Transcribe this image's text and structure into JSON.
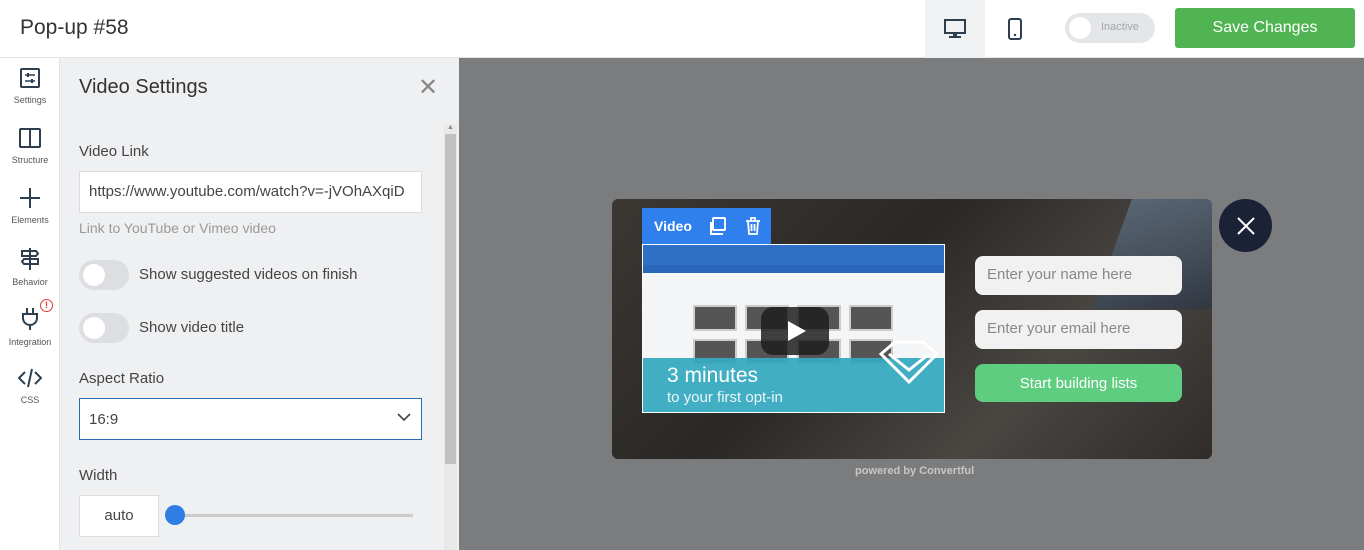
{
  "header": {
    "title": "Pop-up #58",
    "toggle_label": "Inactive",
    "save_label": "Save Changes",
    "devices": [
      "desktop-icon",
      "mobile-icon"
    ]
  },
  "nav": {
    "items": [
      {
        "label": "Settings",
        "icon": "sliders-icon"
      },
      {
        "label": "Structure",
        "icon": "columns-icon"
      },
      {
        "label": "Elements",
        "icon": "plus-icon"
      },
      {
        "label": "Behavior",
        "icon": "signpost-icon"
      },
      {
        "label": "Integration",
        "icon": "plug-icon",
        "badge": "!"
      },
      {
        "label": "CSS",
        "icon": "code-icon"
      }
    ]
  },
  "panel": {
    "title": "Video Settings",
    "video_link_label": "Video Link",
    "video_link_value": "https://www.youtube.com/watch?v=-jVOhAXqiD",
    "video_link_hint": "Link to YouTube or Vimeo video",
    "toggle_suggested": "Show suggested videos on finish",
    "toggle_title": "Show video title",
    "aspect_label": "Aspect Ratio",
    "aspect_value": "16:9",
    "width_label": "Width",
    "width_value": "auto",
    "width_slider": 0
  },
  "popup": {
    "video_toolbar_label": "Video",
    "video_headline": "3 minutes",
    "video_subline": "to your first opt-in",
    "name_placeholder": "Enter your name here",
    "email_placeholder": "Enter your email here",
    "cta_label": "Start building lists",
    "powered_by": "powered by Convertful"
  },
  "colors": {
    "save": "#4fb451",
    "accent": "#2f80ed",
    "cta": "#5fcd7f",
    "close": "#1b2236"
  }
}
